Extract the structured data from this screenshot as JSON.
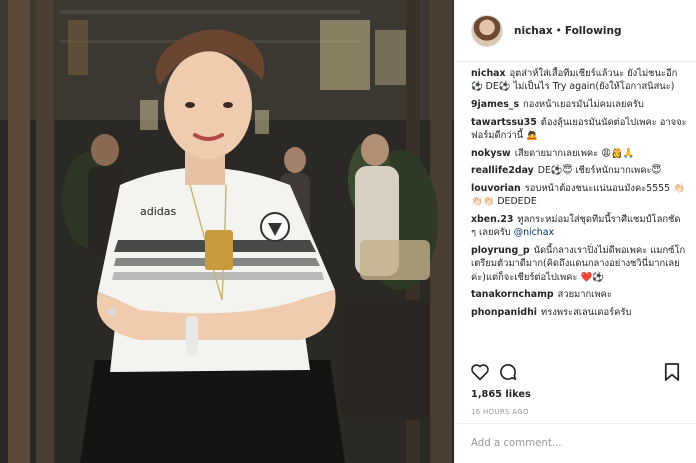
{
  "post": {
    "username": "nichax",
    "dot": "•",
    "following_label": "Following",
    "caption": "อุตส่าห์ใส่เสื้อทีมเชียร์แล้วนะ ยังไม่ชนะอีก⚽ DE⚽ ไม่เป็นไร Try again(ยังให้โอกาสนิสนะ)",
    "likes": "1,865 likes",
    "time_ago": "16 HOURS AGO",
    "add_comment_placeholder": "Add a comment..."
  },
  "comments": [
    {
      "user": "9james_s",
      "text": "กองหน้าเยอรมันไม่คมเลยครับ"
    },
    {
      "user": "tawartssu35",
      "text": "ต้องลุ้นเยอรมันนัดต่อไปเพคะ อาจจะฟอร์มดีกว่านี้ 🙇"
    },
    {
      "user": "nokysw",
      "text": "เสียดายมากเลยเพคะ 😩👸🙏"
    },
    {
      "user": "reallife2day",
      "text": "DE⚽😇 เชียร์หนักมากเพคะ😇"
    },
    {
      "user": "louvorian",
      "text": "รอบหน้าต้องชนะแน่นอนมังคะ5555 👏🏻👏🏻👏🏻 DEDEDE"
    },
    {
      "user": "xben.23",
      "text": "ทูลกระหม่อมใส่ชุดทีมนี้ราศีแชมป์โลกชัด ๆ เลยครับ",
      "mention": "@nichax"
    },
    {
      "user": "ployrung_p",
      "text": "นัดนี้กลางเราปิ่งไม่ดีพอเพคะ แมกซ์โกเตรียมตัวมาดีมาก(คิดถึงแดนกลางอย่างชวินี่มากเลยค่ะ)แต่ก็จะเชียร์ต่อไปเพคะ ❤️⚽"
    },
    {
      "user": "tanakornchamp",
      "text": "สวยมากเพคะ"
    },
    {
      "user": "phonpanidhi",
      "text": "ทรงพระสเลนเดอร์ครับ"
    }
  ],
  "photo": {
    "jersey_brand": "adidas",
    "ring_color": "#c79a3c"
  },
  "icons": {
    "like": "heart-icon",
    "comment": "speech-bubble-icon",
    "save": "bookmark-icon"
  },
  "colors": {
    "text": "#262626",
    "muted": "#999999",
    "mention": "#003569",
    "border": "#efefef"
  }
}
